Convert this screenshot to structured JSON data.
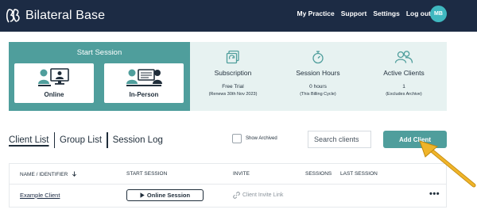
{
  "brand": {
    "name": "Bilateral Base",
    "logo_icon": "bb-logo-icon"
  },
  "nav": {
    "items": [
      "My Practice",
      "Support",
      "Settings",
      "Log out"
    ]
  },
  "avatar": {
    "initials": "MB",
    "color": "#3fb8c0"
  },
  "start_session": {
    "title": "Start Session",
    "options": [
      {
        "label": "Online",
        "icon": "online-session-icon"
      },
      {
        "label": "In-Person",
        "icon": "in-person-session-icon"
      }
    ]
  },
  "stats": [
    {
      "title": "Subscription",
      "value": "Free Trial",
      "note": "(Renews 30th Nov 2023)",
      "icon": "subscription-icon"
    },
    {
      "title": "Session Hours",
      "value": "0 hours",
      "note": "(This Billing Cycle)",
      "icon": "stopwatch-icon"
    },
    {
      "title": "Active Clients",
      "value": "1",
      "note": "(Excludes Archive)",
      "icon": "users-icon"
    }
  ],
  "tabs": [
    "Client List",
    "Group List",
    "Session Log"
  ],
  "show_archived": {
    "label": "Show Archived",
    "checked": false
  },
  "search": {
    "placeholder": "Search clients",
    "value": ""
  },
  "add_client": {
    "label": "Add Client"
  },
  "table": {
    "headers": [
      "NAME / IDENTIFIER",
      "START SESSION",
      "INVITE",
      "SESSIONS",
      "LAST SESSION"
    ],
    "rows": [
      {
        "name": "Example Client",
        "start_session": "Online Session",
        "invite": "Client Invite Link",
        "sessions": "",
        "last_session": ""
      }
    ]
  },
  "colors": {
    "navbar": "#1c2b44",
    "teal": "#4f9e9c",
    "panel_bg": "#e7f2f1",
    "arrow": "#f0b429"
  }
}
